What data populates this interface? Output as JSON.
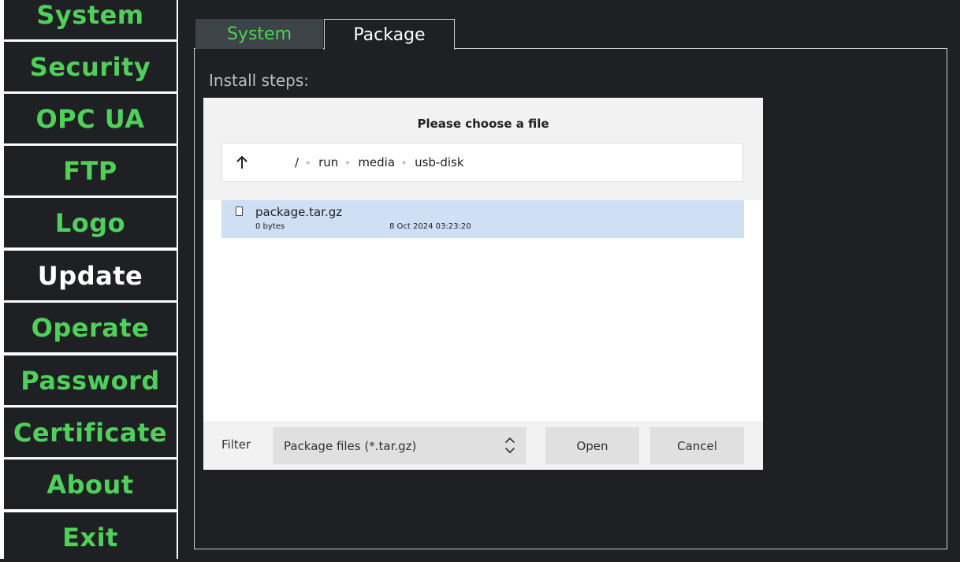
{
  "sidebar": {
    "items": [
      {
        "label": "System"
      },
      {
        "label": "Security"
      },
      {
        "label": "OPC UA"
      },
      {
        "label": "FTP"
      },
      {
        "label": "Logo"
      },
      {
        "label": "Update",
        "active": true
      },
      {
        "label": "Operate"
      },
      {
        "label": "Password"
      },
      {
        "label": "Certificate"
      },
      {
        "label": "About"
      },
      {
        "label": "Exit"
      }
    ]
  },
  "tabs": [
    {
      "label": "System"
    },
    {
      "label": "Package",
      "active": true
    }
  ],
  "panel": {
    "steps_label": "Install steps:"
  },
  "dialog": {
    "title": "Please choose a file",
    "up_icon": "arrow-up-icon",
    "path": [
      "/",
      "run",
      "media",
      "usb-disk"
    ],
    "files": [
      {
        "name": "package.tar.gz",
        "size": "0 bytes",
        "modified": "8 Oct 2024 03:23:20",
        "icon": "file-icon",
        "selected": true
      }
    ],
    "filter_label": "Filter",
    "filter_value": "Package files (*.tar.gz)",
    "open_label": "Open",
    "cancel_label": "Cancel"
  },
  "colors": {
    "background": "#1e2023",
    "accent_green": "#4fd05a",
    "selection": "#cfdff4"
  }
}
